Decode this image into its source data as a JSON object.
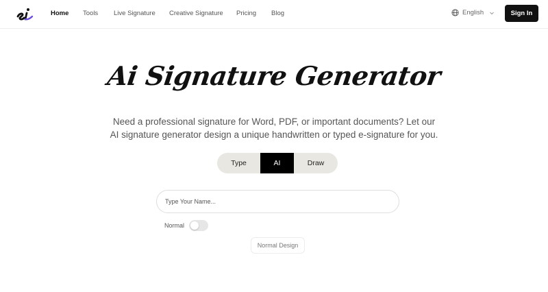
{
  "brand": {
    "logo_text": "si",
    "accent": "#6d4fe0"
  },
  "nav": {
    "items": [
      {
        "label": "Home",
        "active": true
      },
      {
        "label": "Tools",
        "active": false
      },
      {
        "label": "Live Signature",
        "active": false
      },
      {
        "label": "Creative Signature",
        "active": false
      },
      {
        "label": "Pricing",
        "active": false
      },
      {
        "label": "Blog",
        "active": false
      }
    ],
    "language": "English",
    "language_icon": "globe-icon",
    "signin_label": "Sign In"
  },
  "hero": {
    "title": "Ai Signature Generator",
    "subtitle": "Need a professional signature for Word, PDF, or important documents? Let our AI signature generator design a unique handwritten or typed e-signature for you."
  },
  "tabs": [
    {
      "label": "Type",
      "active": false
    },
    {
      "label": "AI",
      "active": true
    },
    {
      "label": "Draw",
      "active": false
    }
  ],
  "form": {
    "name_placeholder": "Type Your Name...",
    "name_value": "",
    "mode_label": "Normal",
    "toggle_on": false,
    "design_button": "Normal Design"
  }
}
